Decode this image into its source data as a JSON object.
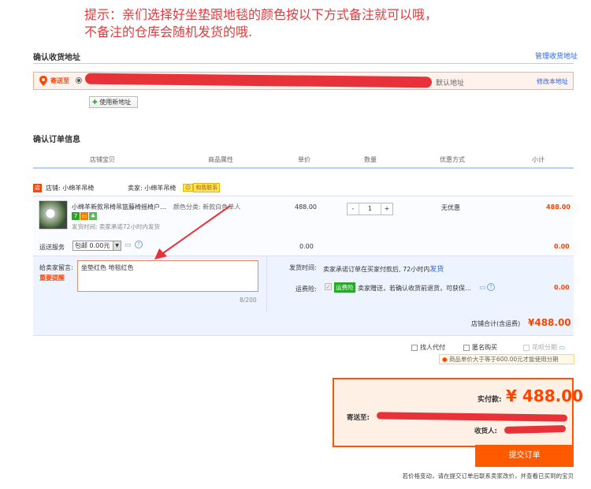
{
  "notice": {
    "line1": "提示：亲们选择好坐垫跟地毯的颜色按以下方式备注就可以哦，",
    "line2": "不备注的仓库会随机发货的哦."
  },
  "address": {
    "section_title": "确认收货地址",
    "manage_link": "管理收货地址",
    "ship_to_label": "寄送至",
    "default_label": "默认地址",
    "edit_link": "修改本地址",
    "use_new_label": "使用新地址"
  },
  "order": {
    "section_title": "确认订单信息",
    "columns": [
      "店铺宝贝",
      "商品属性",
      "单价",
      "数量",
      "优惠方式",
      "小计"
    ],
    "shop_label": "店铺: 小绵羊吊椅",
    "seller_label": "卖家: 小绵羊吊椅",
    "contact_label": "和我联系",
    "item_title": "小绵羊新款吊椅吊篮藤椅摇椅户…",
    "item_attr": "颜色分类: 新款白色单人",
    "ship_time_note": "发货时间: 卖家承诺72小时内发货",
    "unit_price": "488.00",
    "quantity": "1",
    "qty_minus": "-",
    "qty_plus": "+",
    "discount": "无优惠",
    "subtotal": "488.00",
    "delivery_label": "运送服务",
    "delivery_option": "包邮  0.00元",
    "delivery_price": "0.00",
    "delivery_subtotal": "0.00",
    "message_label": "给卖家留言:",
    "important_label": "重要提醒",
    "message_text": "坐垫红色   地毯红色",
    "char_count": "8/200",
    "ship_time_label": "发货时间:",
    "ship_time_text": "卖家承诺订单在买家付款后, 72小时内",
    "ship_time_link": "发货",
    "insurance_label": "运费险:",
    "insurance_badge": "运费险",
    "insurance_text": "卖家赠送，若确认收货前退货，可获保…",
    "insurance_price": "0.00",
    "shop_total_label": "店铺合计(含运费)",
    "shop_total_value": "¥488.00",
    "badge_seven": "7"
  },
  "options": {
    "proxy_pay": "找人代付",
    "anonymous": "匿名购买",
    "installment": "花呗分期",
    "installment_note": "商品单价大于等于600.00元才能使用分期"
  },
  "payment": {
    "actual_label": "实付款:",
    "actual_value": "¥ 488.00",
    "ship_to_label": "寄送至:",
    "receiver_label": "收货人:",
    "submit_label": "提交订单",
    "footer_note": "若价格变动，请在提交订单后联系卖家改价，并查看已买到的宝贝"
  },
  "colors": {
    "accent": "#ff5500",
    "notice_red": "#e4393c",
    "link_blue": "#3366cc",
    "header_line": "#b2d1ff"
  }
}
